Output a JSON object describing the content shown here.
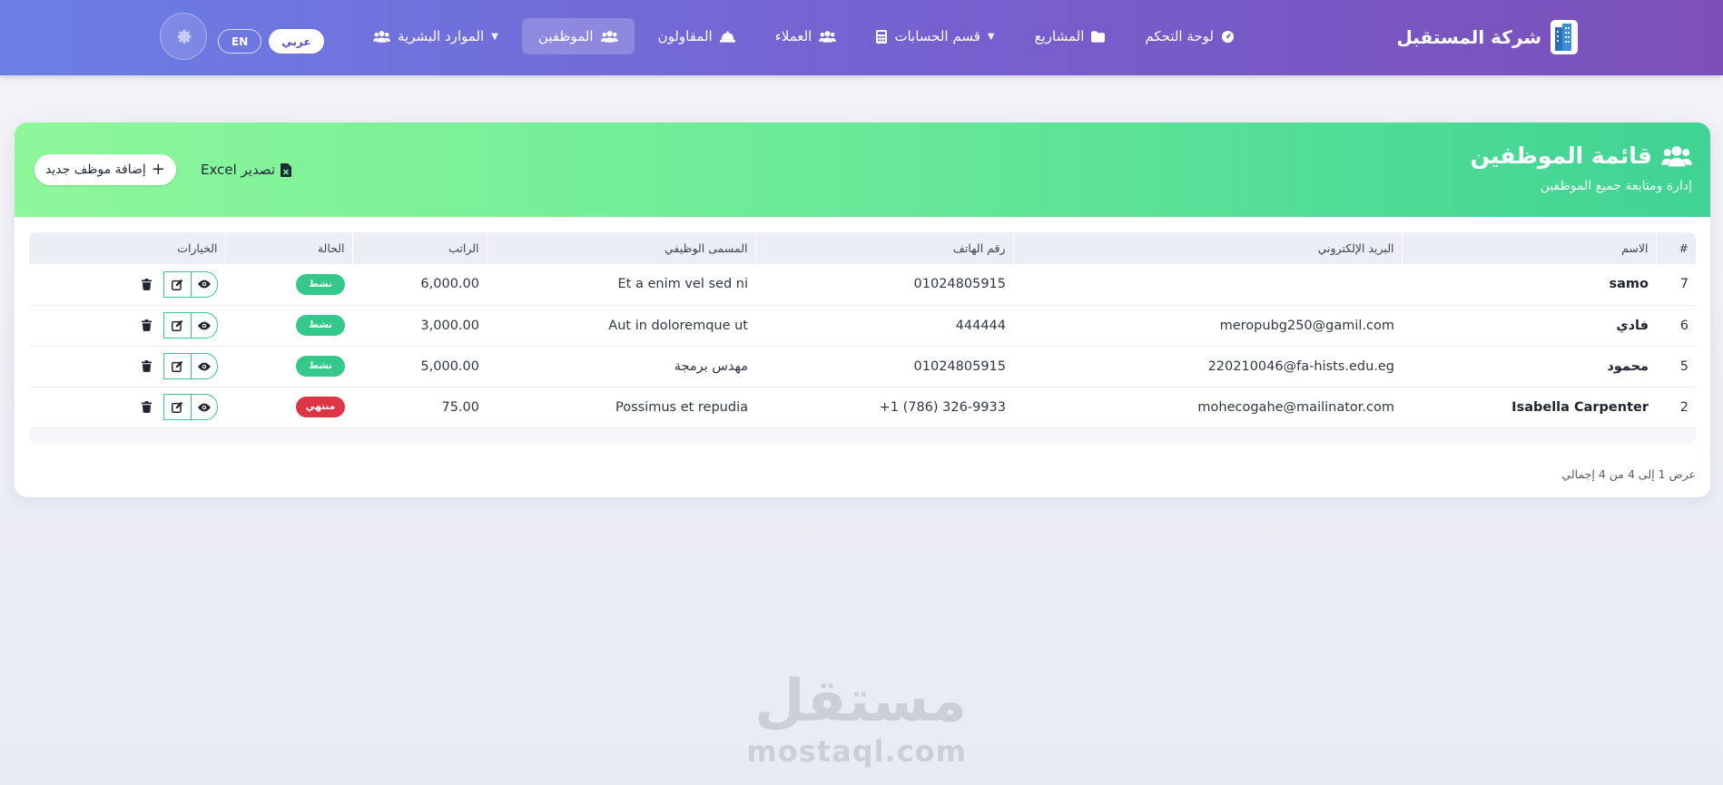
{
  "brand": {
    "title": "شركة المستقبل",
    "logo_icon": "building-icon"
  },
  "nav": {
    "items": [
      {
        "label": "لوحة التحكم",
        "icon": "dashboard-icon"
      },
      {
        "label": "المشاريع",
        "icon": "folder-icon"
      },
      {
        "label": "قسم الحسابات",
        "icon": "calculator-icon"
      },
      {
        "label": "العملاء",
        "icon": "users-icon"
      },
      {
        "label": "المقاولون",
        "icon": "hardhat-icon"
      },
      {
        "label": "الموظفين",
        "icon": "users-icon"
      },
      {
        "label": "الموارد البشرية",
        "icon": "users-icon"
      }
    ],
    "active": "الموظفين"
  },
  "lang": {
    "arabic": "عربي",
    "english": "EN"
  },
  "header": {
    "title": "قائمة الموظفين",
    "subtitle": "إدارة ومتابعة جميع الموظفين",
    "export_label": "تصدير Excel",
    "add_label": "إضافة موظف جديد"
  },
  "table": {
    "columns": [
      "#",
      "الاسم",
      "البريد الإلكتروني",
      "رقم الهاتف",
      "المسمى الوظيفي",
      "الراتب",
      "الحالة",
      "الخيارات"
    ],
    "rows": [
      {
        "id": "7",
        "name": "samo",
        "email": "",
        "phone": "01024805915",
        "job": "Et a enim vel sed ni",
        "salary": "6,000.00",
        "status": "نشط",
        "status_type": "active"
      },
      {
        "id": "6",
        "name": "فادي",
        "email": "meropubg250@gamil.com",
        "phone": "444444",
        "job": "Aut in doloremque ut",
        "salary": "3,000.00",
        "status": "نشط",
        "status_type": "active"
      },
      {
        "id": "5",
        "name": "محمود",
        "email": "220210046@fa-hists.edu.eg",
        "phone": "01024805915",
        "job": "مهدس برمجة",
        "salary": "5,000.00",
        "status": "نشط",
        "status_type": "active"
      },
      {
        "id": "2",
        "name": "Isabella Carpenter",
        "email": "mohecogahe@mailinator.com",
        "phone": "+1 (786) 326-9933",
        "job": "Possimus et repudia",
        "salary": "75.00",
        "status": "منتهي",
        "status_type": "ended"
      }
    ]
  },
  "footer": {
    "info": "عرض 1 إلى 4 من 4 إجمالي"
  },
  "watermark": {
    "arabic": "مستقل",
    "latin": "mostaql.com"
  },
  "colors": {
    "nav_start": "#6b7fe6",
    "nav_end": "#7b4fb8",
    "header_start": "#8ef79a",
    "header_end": "#3fd394",
    "badge_active": "#34c98b",
    "badge_ended": "#dc3545"
  }
}
